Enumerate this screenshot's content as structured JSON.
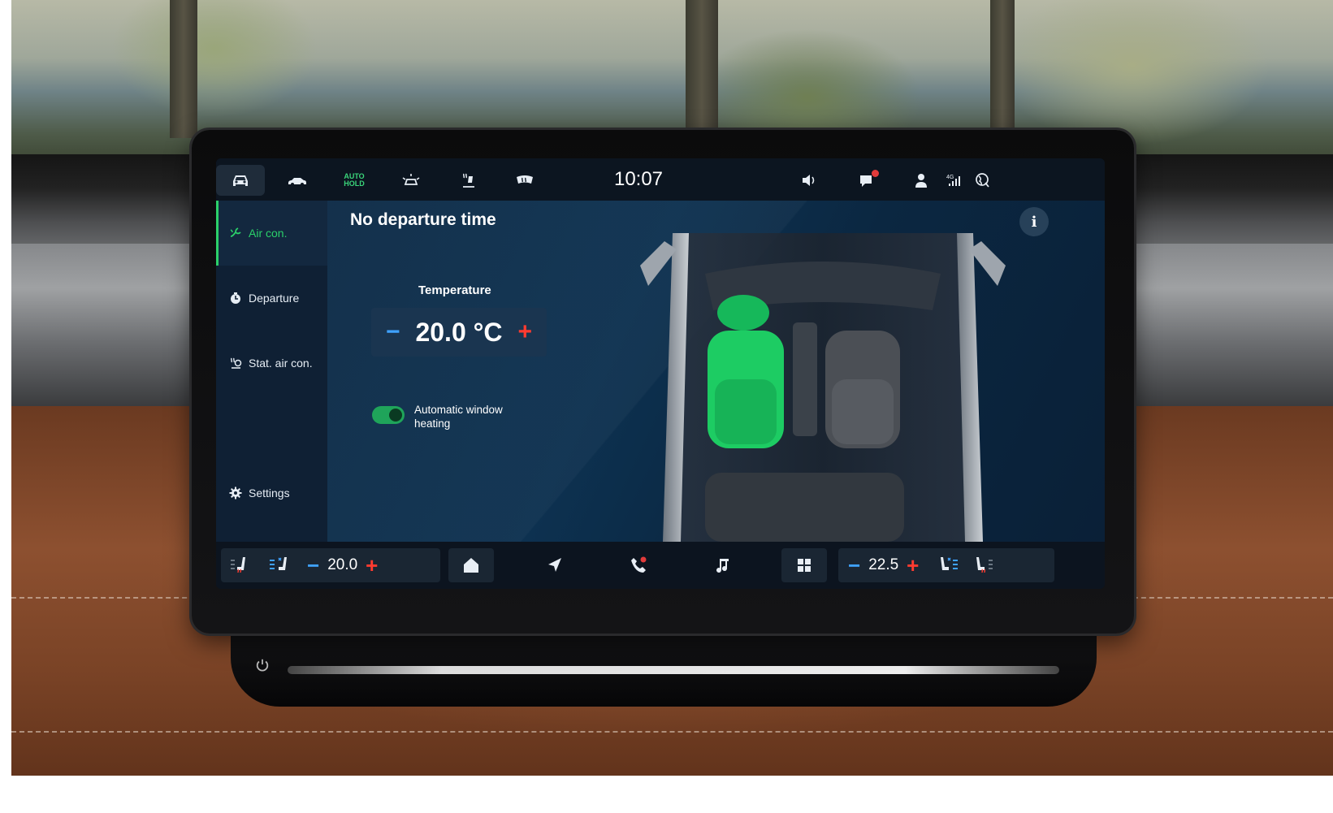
{
  "status_bar": {
    "clock": "10:07",
    "auto_hold_line1": "AUTO",
    "auto_hold_line2": "HOLD",
    "network": "4G",
    "icons": [
      "car-icon",
      "car-side-icon",
      "auto-hold-icon",
      "driver-assist-icon",
      "seat-heating-icon",
      "windshield-heating-icon",
      "volume-icon",
      "notification-icon",
      "profile-icon",
      "signal-icon",
      "globe-icon"
    ]
  },
  "sidebar": {
    "items": [
      {
        "label": "Air con.",
        "icon": "fan-icon",
        "active": true
      },
      {
        "label": "Departure",
        "icon": "clock-icon",
        "active": false
      },
      {
        "label": "Stat. air con.",
        "icon": "stationary-air-icon",
        "active": false
      },
      {
        "label": "Settings",
        "icon": "gear-icon",
        "active": false
      }
    ]
  },
  "main": {
    "title": "No departure time",
    "temperature": {
      "label": "Temperature",
      "value": "20.0 °C",
      "minus": "−",
      "plus": "+"
    },
    "auto_window_heating": {
      "label": "Automatic window heating",
      "enabled": true
    },
    "info": "i",
    "active_zone": "driver"
  },
  "bottom_bar": {
    "left_temp": "20.0",
    "right_temp": "22.5",
    "minus": "−",
    "plus": "+",
    "items": [
      "home-icon",
      "navigation-icon",
      "phone-icon",
      "music-icon",
      "apps-icon"
    ]
  },
  "colors": {
    "accent_green": "#2bd06a",
    "minus_blue": "#3fa2ff",
    "plus_red": "#ff3b30",
    "screen_bg": "#0a1523"
  }
}
